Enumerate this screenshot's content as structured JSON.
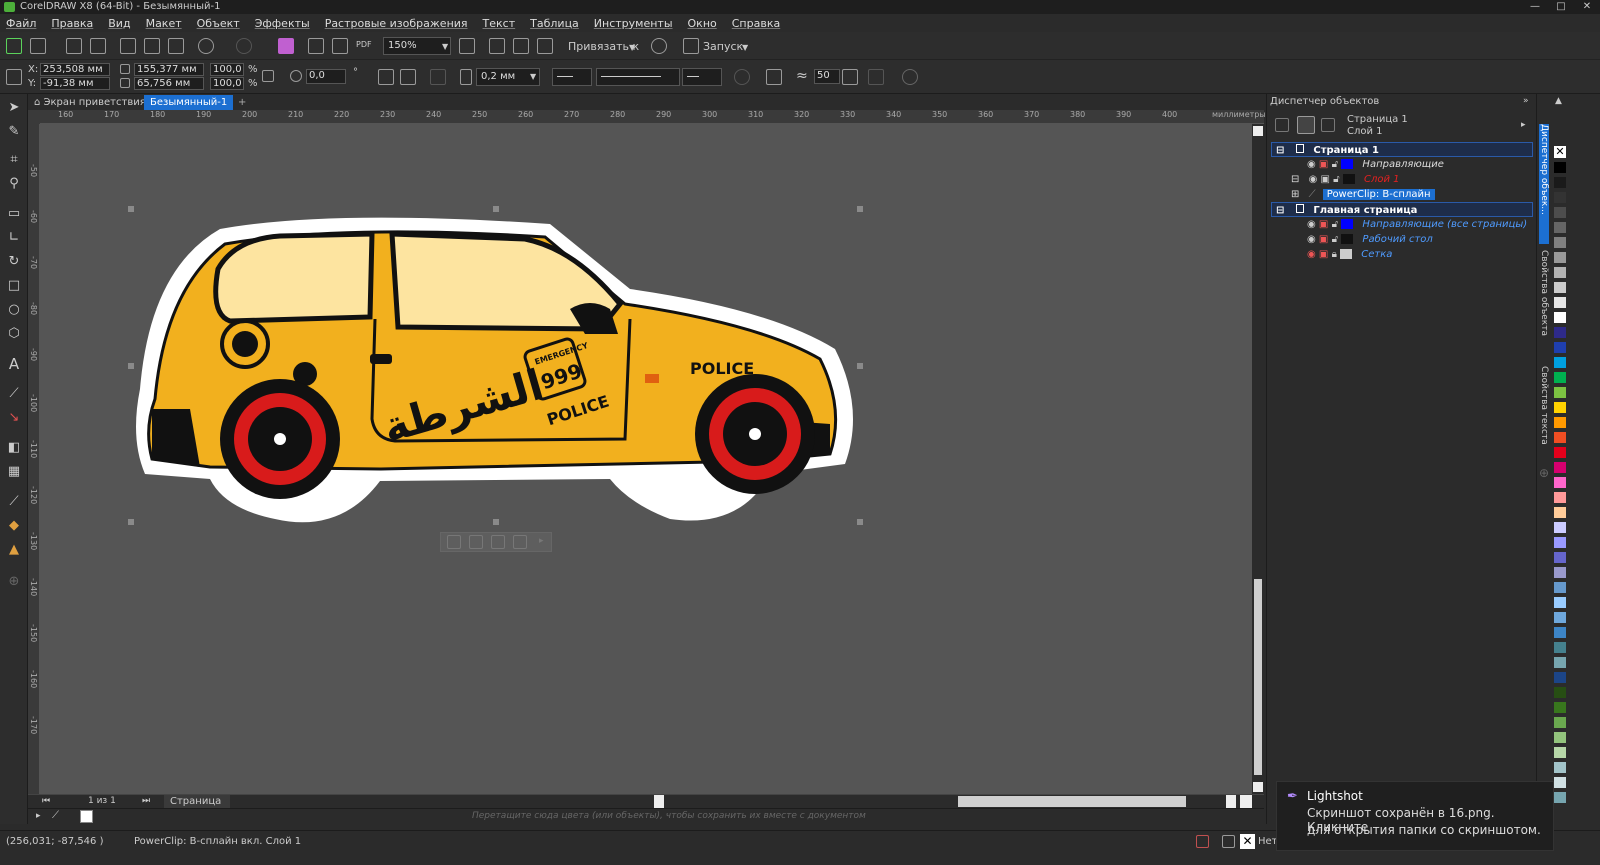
{
  "title": {
    "window": "CorelDRAW X8 (64-Bit) - Безымянный-1"
  },
  "window_controls": {
    "minimize": "—",
    "maximize": "□",
    "close": "✕"
  },
  "menu": [
    "Файл",
    "Правка",
    "Вид",
    "Макет",
    "Объект",
    "Эффекты",
    "Растровые изображения",
    "Текст",
    "Таблица",
    "Инструменты",
    "Окно",
    "Справка"
  ],
  "toolbar": {
    "zoom": "150%",
    "snap_label": "Привязать к",
    "launch_label": "Запуск",
    "pdf": "PDF"
  },
  "propbar": {
    "x_label": "X:",
    "x": "253,508 мм",
    "y_label": "Y:",
    "y": "-91,38 мм",
    "w": "155,377 мм",
    "h": "65,756 мм",
    "scale_x": "100,0",
    "scale_y": "100,0",
    "pct": "%",
    "angle": "0,0",
    "deg": "°",
    "outline_width": "0,2 мм",
    "dash": "50"
  },
  "tabs": {
    "welcome": "Экран приветствия",
    "doc": "Безымянный-1",
    "add": "+"
  },
  "ruler": {
    "h_ticks": [
      "160",
      "170",
      "180",
      "190",
      "200",
      "210",
      "220",
      "230",
      "240",
      "250",
      "260",
      "270",
      "280",
      "290",
      "300",
      "310",
      "320",
      "330",
      "340",
      "350",
      "360",
      "370",
      "380",
      "390",
      "400"
    ],
    "units": "миллиметры",
    "v_ticks": [
      "-50",
      "-60",
      "-70",
      "-80",
      "-90",
      "-100",
      "-110",
      "-120",
      "-130",
      "-140",
      "-150",
      "-160",
      "-170"
    ]
  },
  "art": {
    "car_text_police": "POLICE",
    "badge_emergency": "EMERGENCY",
    "badge_999": "999",
    "badge_police": "POLICE",
    "arabic": "الشرطة"
  },
  "bottom": {
    "page_count": "1 из 1",
    "page_tab": "Страница 1",
    "palette_hint": "Перетащите сюда цвета (или объекты), чтобы сохранить их вместе с документом"
  },
  "status": {
    "coords": "(256,031; -87,546 )",
    "selection": "PowerClip: В-сплайн вкл. Слой 1",
    "none": "Нет"
  },
  "objmgr": {
    "title": "Диспетчер объектов",
    "page": "Страница 1",
    "layer": "Слой 1",
    "rows": [
      {
        "label": "Страница 1",
        "kind": "head"
      },
      {
        "label": "Направляющие",
        "kind": "guides"
      },
      {
        "label": "Слой 1",
        "kind": "layer"
      },
      {
        "label": "PowerClip: В-сплайн",
        "kind": "object"
      },
      {
        "label": "Главная страница",
        "kind": "head"
      },
      {
        "label": "Направляющие (все страницы)",
        "kind": "master"
      },
      {
        "label": "Рабочий стол",
        "kind": "master"
      },
      {
        "label": "Сетка",
        "kind": "master"
      }
    ]
  },
  "sidetabs": [
    "Диспетчер объек...",
    "Свойства объекта",
    "Свойства текста"
  ],
  "palette_colors": [
    "#000000",
    "#1a1a1a",
    "#333333",
    "#4d4d4d",
    "#666666",
    "#808080",
    "#999999",
    "#b3b3b3",
    "#cccccc",
    "#e6e6e6",
    "#ffffff",
    "#2e2a8a",
    "#1f3fae",
    "#00a0e0",
    "#00b050",
    "#7cc242",
    "#ffd200",
    "#ff9900",
    "#f04e23",
    "#e4001b",
    "#d6006f",
    "#ff66cc",
    "#ff9999",
    "#ffcc99",
    "#ccccff",
    "#9999ff",
    "#6666cc",
    "#9999cc",
    "#6699cc",
    "#99ccff",
    "#6fa8dc",
    "#3d85c6",
    "#45818e",
    "#76a5af",
    "#1c4587",
    "#274e13",
    "#38761d",
    "#6aa84f",
    "#93c47d",
    "#b6d7a8",
    "#a2c4c9",
    "#d0e0e3",
    "#76a5af"
  ],
  "notification": {
    "app": "Lightshot",
    "line1": "Скриншот сохранён в 16.png. Кликните",
    "line2": "для открытия папки со скриншотом."
  }
}
